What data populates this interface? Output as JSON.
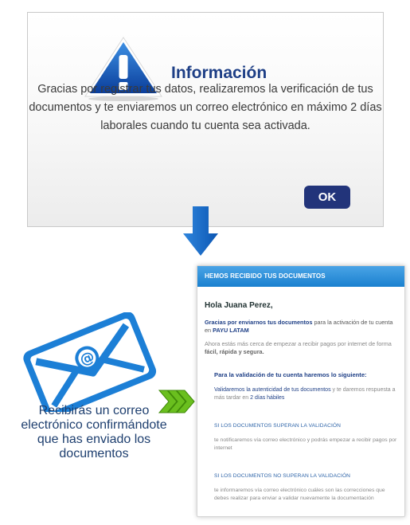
{
  "dialog": {
    "title": "Información",
    "message": "Gracias por registrar tus datos, realizaremos la verificación de tus documentos y te enviaremos un correo electrónico en máximo 2 días laborales cuando tu cuenta sea activada.",
    "ok_label": "OK"
  },
  "caption": "Recibirás un correo electrónico confirmándote que has enviado los documentos",
  "email": {
    "header": "HEMOS RECIBIDO TUS DOCUMENTOS",
    "greeting": "Hola Juana Perez,",
    "p1_bold": "Gracias por enviarnos tus documentos",
    "p1_rest": " para la activación de tu cuenta en ",
    "p1_brand": "PAYU LATAM",
    "p2_start": "Ahora estás más cerca de empezar a recibir pagos por internet de forma ",
    "p2_bold": "fácil, rápida y segura.",
    "p3": "Para la validación de tu cuenta haremos lo siguiente:",
    "p4_bold": "Validaremos la autenticidad de tus documentos",
    "p4_rest": " y te daremos respuesta a más tardar en ",
    "p4_days": "2 días hábiles",
    "h2": "SI LOS DOCUMENTOS SUPERAN LA VALIDACIÓN",
    "p5": "te notificaremos vía correo electrónico y podrás empezar a recibir pagos por internet",
    "h3": "SI LOS DOCUMENTOS NO SUPERAN LA VALIDACIÓN",
    "p6": "te informaremos vía correo electrónico cuáles son las correcciones que debes realizar para enviar a validar nuevamente la documentación"
  },
  "colors": {
    "brand_navy": "#1e3f86",
    "ok_button": "#22347a",
    "accent_blue": "#1a80cf",
    "arrow_green": "#6abf1e"
  },
  "icons": [
    "warning-icon",
    "down-arrow-icon",
    "envelope-icon",
    "chevrons-right-icon"
  ]
}
